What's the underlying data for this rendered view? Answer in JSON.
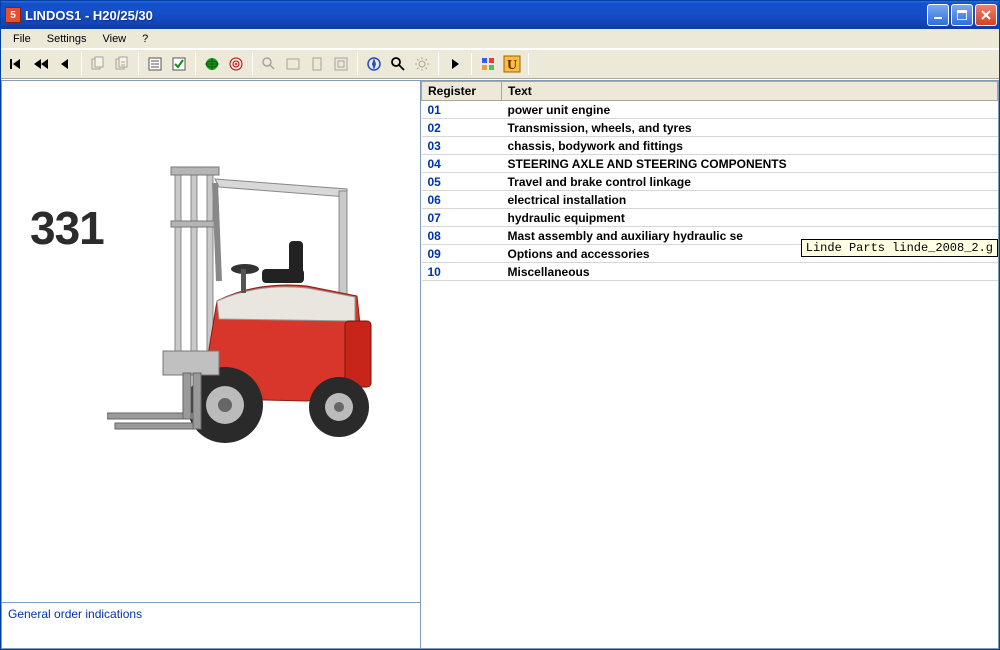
{
  "window": {
    "title": "LINDOS1 - H20/25/30",
    "icon_text": "5"
  },
  "menu": {
    "file": "File",
    "settings": "Settings",
    "view": "View",
    "help": "?"
  },
  "left": {
    "model_number": "331",
    "bottom_note": "General order indications"
  },
  "table": {
    "header_register": "Register",
    "header_text": "Text",
    "rows": [
      {
        "reg": "01",
        "text": "power unit engine"
      },
      {
        "reg": "02",
        "text": "Transmission, wheels, and tyres"
      },
      {
        "reg": "03",
        "text": "chassis, bodywork and fittings"
      },
      {
        "reg": "04",
        "text": "STEERING AXLE AND STEERING COMPONENTS"
      },
      {
        "reg": "05",
        "text": "Travel and brake control linkage"
      },
      {
        "reg": "06",
        "text": "electrical installation"
      },
      {
        "reg": "07",
        "text": "hydraulic equipment"
      },
      {
        "reg": "08",
        "text": "Mast assembly and auxiliary hydraulic se"
      },
      {
        "reg": "09",
        "text": "Options and accessories"
      },
      {
        "reg": "10",
        "text": "Miscellaneous"
      }
    ]
  },
  "tooltip": "Linde Parts linde_2008_2.g"
}
